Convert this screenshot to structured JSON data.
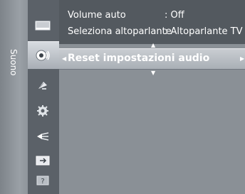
{
  "sidebar": {
    "title": "Suono"
  },
  "menu": {
    "rows": [
      {
        "label": "Volume auto",
        "value": ": Off"
      },
      {
        "label": "Seleziona altoparlante",
        "value": ": Altoparlante TV"
      }
    ],
    "selected": {
      "label": "Reset impostazioni audio"
    }
  },
  "icons": [
    "picture-icon",
    "sound-icon",
    "channel-icon",
    "setup-icon",
    "input-icon",
    "application-icon",
    "support-icon"
  ]
}
